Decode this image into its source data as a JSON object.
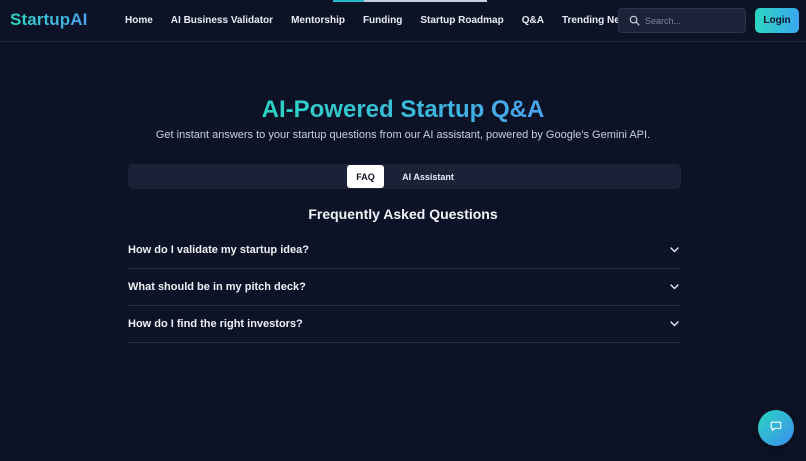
{
  "brand": {
    "logo": "StartupAI",
    "accent": "#2bd4c2",
    "accent2": "#4aa3f0"
  },
  "nav": {
    "items": [
      {
        "label": "Home"
      },
      {
        "label": "AI Business Validator"
      },
      {
        "label": "Mentorship"
      },
      {
        "label": "Funding"
      },
      {
        "label": "Startup Roadmap"
      },
      {
        "label": "Q&A"
      },
      {
        "label": "Trending News"
      }
    ]
  },
  "header": {
    "progress_fraction": 0.2
  },
  "search": {
    "placeholder": "Search...",
    "value": "",
    "icon": "search-icon"
  },
  "auth": {
    "login_label": "Login"
  },
  "hero": {
    "title": "AI-Powered Startup Q&A",
    "subtitle": "Get instant answers to your startup questions from our AI assistant, powered by Google's Gemini API."
  },
  "tabs": [
    {
      "label": "FAQ",
      "active": true
    },
    {
      "label": "AI Assistant",
      "active": false
    }
  ],
  "faq": {
    "title": "Frequently Asked Questions",
    "items": [
      {
        "question": "How do I validate my startup idea?"
      },
      {
        "question": "What should be in my pitch deck?"
      },
      {
        "question": "How do I find the right investors?"
      }
    ]
  },
  "chat": {
    "icon": "chat-icon"
  },
  "colors": {
    "background": "#0d1326",
    "surface": "#1a2238",
    "border": "#273049"
  }
}
